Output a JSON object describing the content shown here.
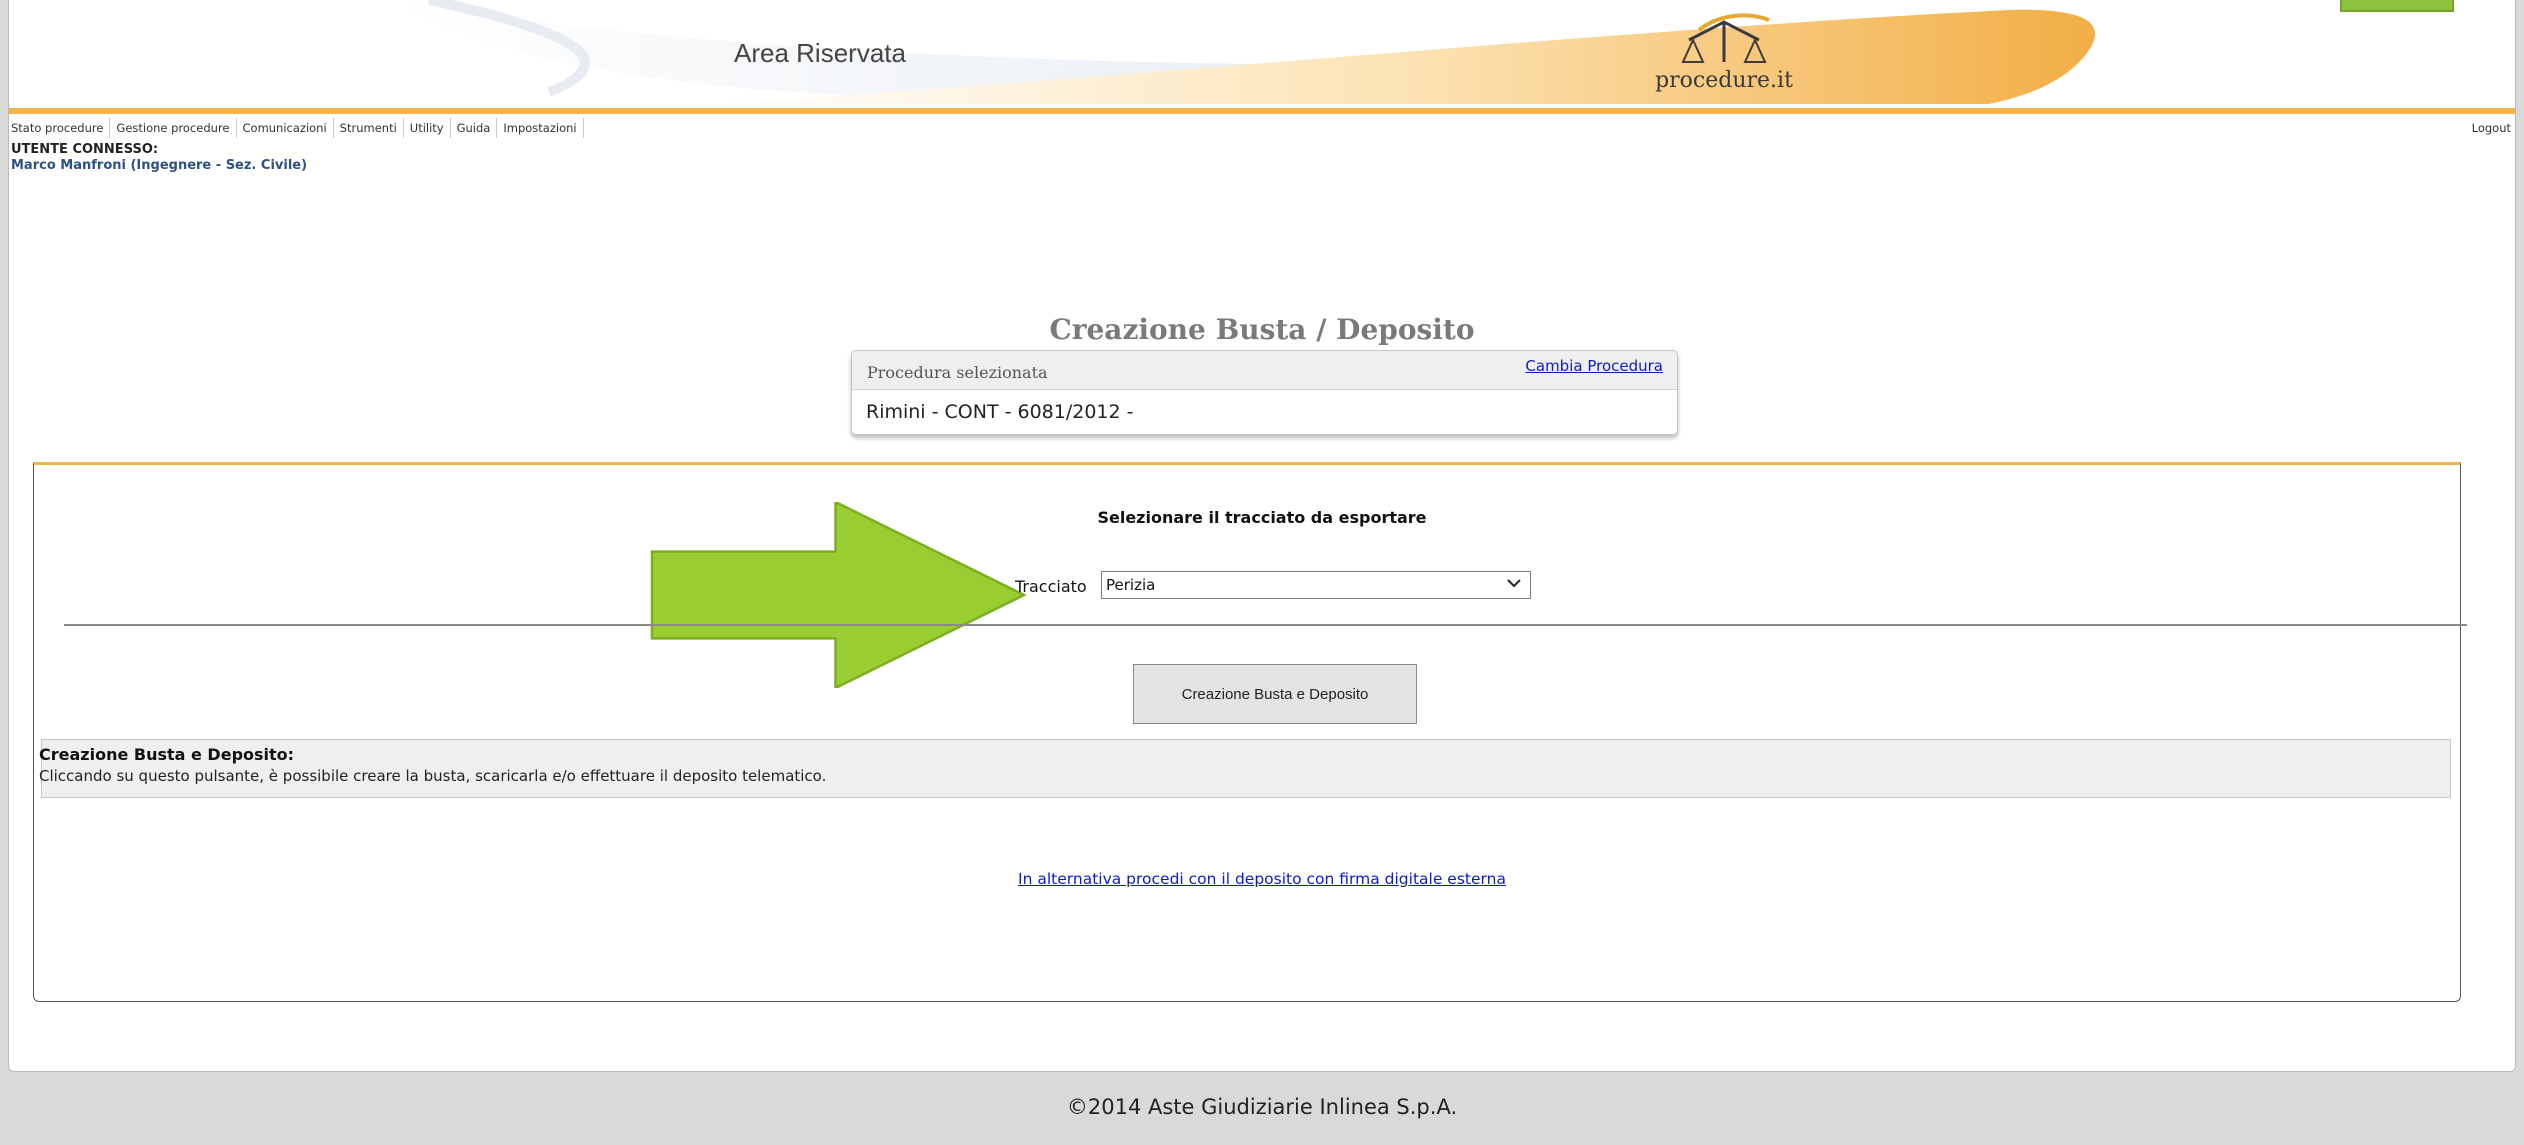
{
  "header": {
    "area_title": "Area Riservata",
    "logo_text": "procedure.it"
  },
  "menu": {
    "items": [
      {
        "label": "Stato procedure"
      },
      {
        "label": "Gestione procedure"
      },
      {
        "label": "Comunicazioni"
      },
      {
        "label": "Strumenti"
      },
      {
        "label": "Utility"
      },
      {
        "label": "Guida"
      },
      {
        "label": "Impostazioni"
      }
    ],
    "logout": "Logout"
  },
  "user": {
    "label": "UTENTE CONNESSO:",
    "name": "Marco Manfroni (Ingegnere - Sez. Civile)"
  },
  "page": {
    "title": "Creazione Busta / Deposito"
  },
  "procedure": {
    "label": "Procedura selezionata",
    "change_link": "Cambia Procedura",
    "value": "Rimini - CONT - 6081/2012 -"
  },
  "form": {
    "title": "Selezionare il tracciato da esportare",
    "tracciato_label": "Tracciato",
    "tracciato_value": "Perizia",
    "create_button": "Creazione Busta e Deposito"
  },
  "info": {
    "title": "Creazione Busta e Deposito:",
    "text": "Cliccando su questo pulsante, è possibile creare la busta, scaricarla e/o effettuare il deposito telematico."
  },
  "alt_link": "In alternativa procedi con il deposito con firma digitale esterna",
  "footer": "©2014 Aste Giudiziarie Inlinea S.p.A.",
  "colors": {
    "accent_orange": "#f0b64a",
    "arrow_green": "#9acd32",
    "link_blue": "#0b1cc7",
    "user_blue": "#2e5183"
  }
}
